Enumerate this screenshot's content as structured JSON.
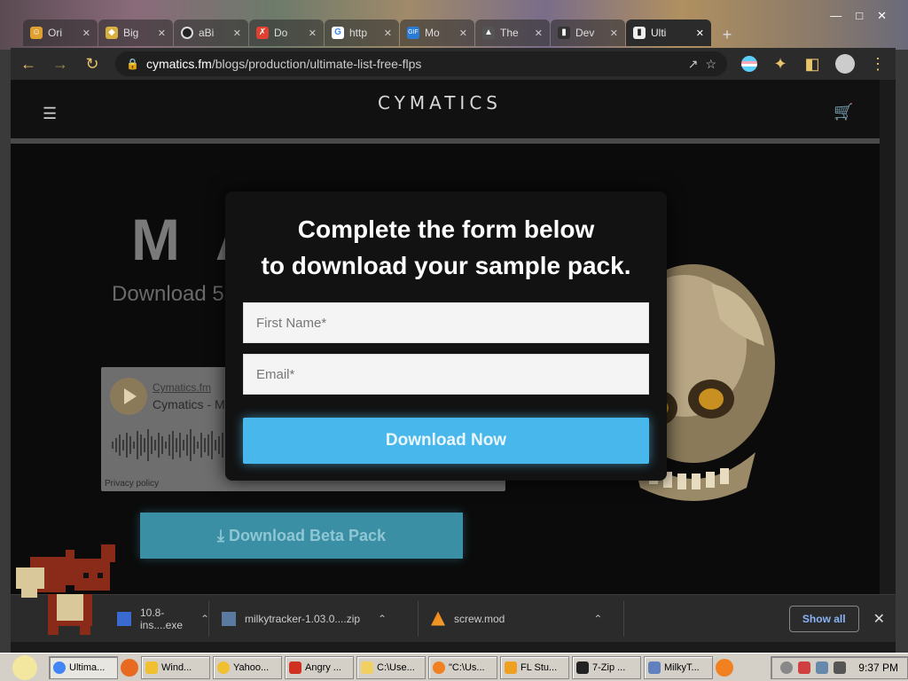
{
  "browser": {
    "tabs": [
      {
        "title": "Ori",
        "icon": "smiley-icon",
        "color": "#e0a030"
      },
      {
        "title": "Big",
        "icon": "diamond-icon",
        "color": "#d8b040"
      },
      {
        "title": "aBi",
        "icon": "circle-icon",
        "color": "#222222"
      },
      {
        "title": "Do",
        "icon": "x-icon",
        "color": "#e04030"
      },
      {
        "title": "http",
        "icon": "google-icon",
        "color": "#4285f4"
      },
      {
        "title": "Mo",
        "icon": "gif-icon",
        "color": "#2a7ad8"
      },
      {
        "title": "The",
        "icon": "chart-icon",
        "color": "#555555"
      },
      {
        "title": "Dev",
        "icon": "piano-icon",
        "color": "#333333"
      },
      {
        "title": "Ulti",
        "icon": "piano-icon",
        "color": "#333333",
        "active": true
      }
    ],
    "new_tab": "+",
    "url_domain": "cymatics.fm",
    "url_path": "/blogs/production/ultimate-list-free-flps"
  },
  "site": {
    "logo": "CYMATICS",
    "hero_title": "M A",
    "hero_subtitle": "Download 5",
    "player": {
      "link": "Cymatics.fm",
      "track": "Cymatics - M",
      "privacy": "Privacy policy"
    },
    "beta_button": "Download Beta Pack"
  },
  "modal": {
    "heading_line1": "Complete the form below",
    "heading_line2": "to download your sample pack.",
    "first_name_placeholder": "First Name*",
    "email_placeholder": "Email*",
    "submit_label": "Download Now"
  },
  "downloads": [
    {
      "name": "10.8-ins....exe",
      "icon": "installer-icon",
      "color": "#3a6ad0"
    },
    {
      "name": "milkytracker-1.03.0....zip",
      "icon": "zip-icon",
      "color": "#5a7aa0"
    },
    {
      "name": "screw.mod",
      "icon": "vlc-icon",
      "color": "#f08010"
    }
  ],
  "show_all_label": "Show all",
  "taskbar": {
    "items": [
      {
        "label": "Ultima...",
        "color": "#4285f4",
        "active": true
      },
      {
        "label": "Wind...",
        "color": "#f0c030"
      },
      {
        "label": "Yahoo...",
        "color": "#f0c030"
      },
      {
        "label": "Angry ...",
        "color": "#d03020"
      },
      {
        "label": "C:\\Use...",
        "color": "#f0d060"
      },
      {
        "label": "\"C:\\Us...",
        "color": "#f08020"
      },
      {
        "label": "FL Stu...",
        "color": "#f0a020"
      },
      {
        "label": "7-Zip ...",
        "color": "#222222"
      },
      {
        "label": "MilkyT...",
        "color": "#6080c0"
      }
    ],
    "clock": "9:37 PM"
  }
}
